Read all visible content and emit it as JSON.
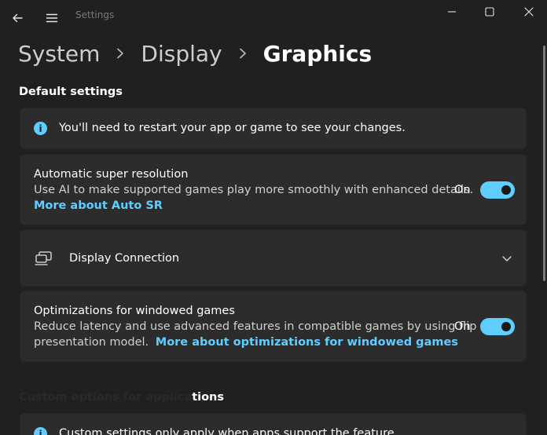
{
  "window": {
    "title": "Settings",
    "controls": {
      "minimize": "minimize",
      "maximize": "maximize",
      "close": "close"
    }
  },
  "breadcrumb": [
    {
      "label": "System"
    },
    {
      "label": "Display"
    },
    {
      "label": "Graphics"
    }
  ],
  "default_settings": {
    "heading": "Default settings",
    "info": {
      "icon": "info-icon",
      "text": "You'll need to restart your app or game to see your changes."
    },
    "auto_sr": {
      "title": "Automatic super resolution",
      "description": "Use AI to make supported games play more smoothly with enhanced details.",
      "link": "More about Auto SR",
      "toggle_label": "On",
      "toggle_on": true
    },
    "display_connection": {
      "icon": "display-connection-icon",
      "label": "Display Connection"
    },
    "windowed_games": {
      "title": "Optimizations for windowed games",
      "description_line1": "Reduce latency and use advanced features in compatible games by using flip",
      "description_line2": "presentation model.",
      "link": "More about optimizations for windowed games",
      "toggle_label": "On",
      "toggle_on": true
    }
  },
  "custom_settings": {
    "heading_visible": "tions",
    "info_text": "Custom settings only apply when apps support the feature"
  },
  "colors": {
    "background": "#202020",
    "card": "#2c2c2c",
    "accent": "#60cdff"
  }
}
